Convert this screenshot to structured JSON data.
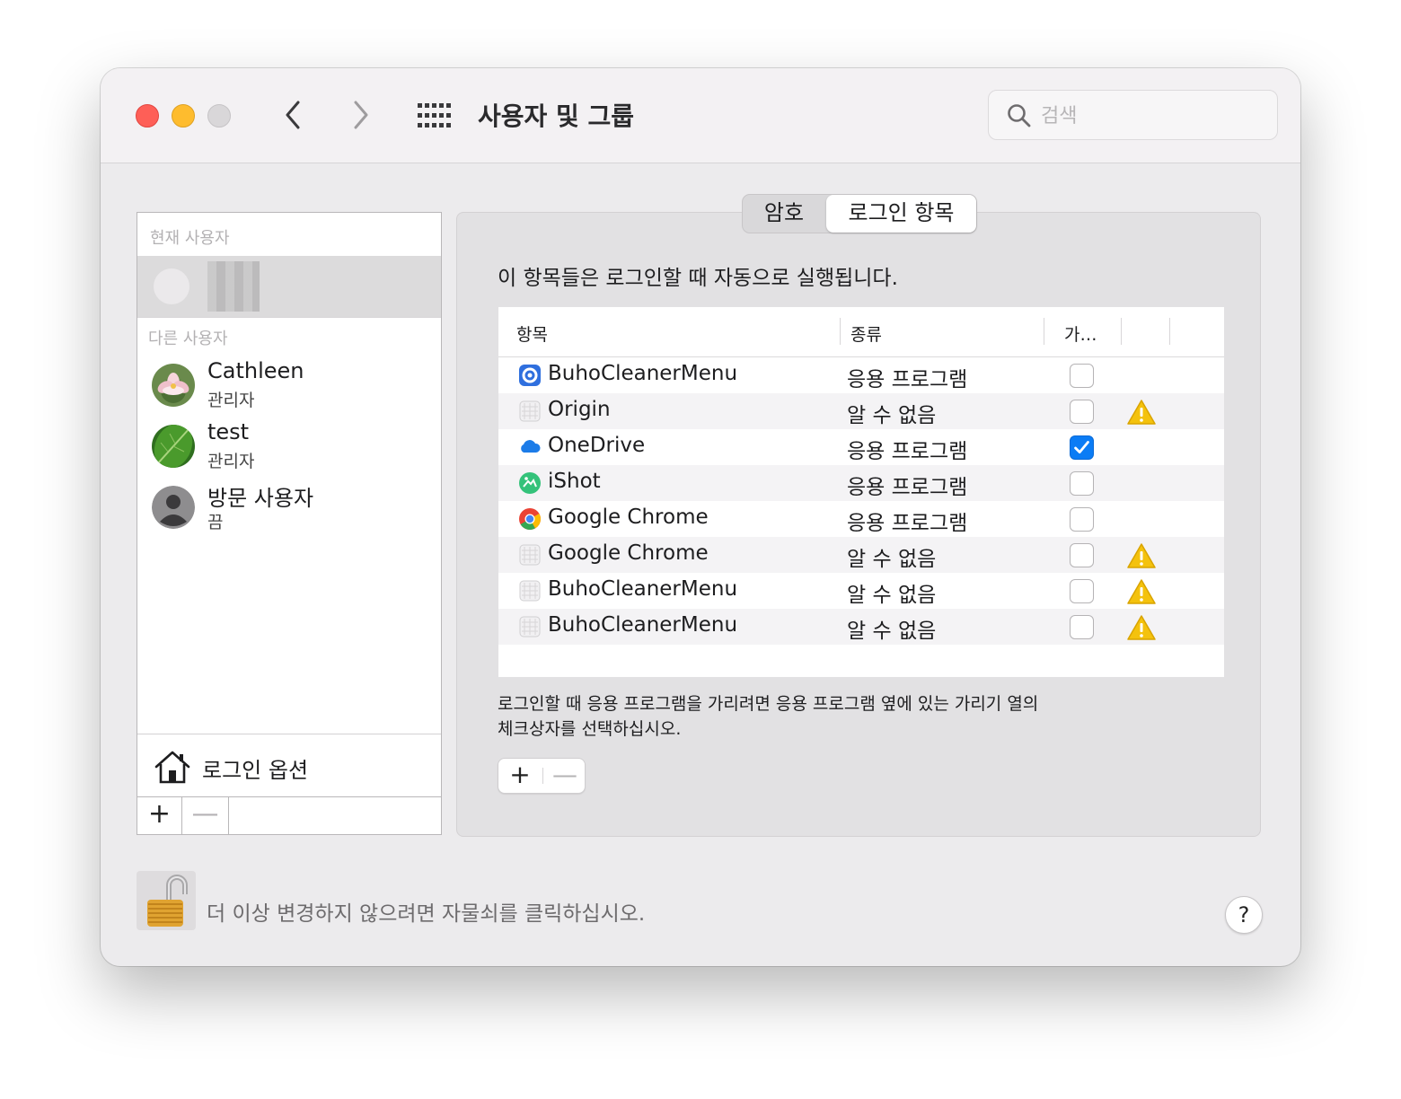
{
  "window": {
    "title": "사용자 및 그룹",
    "search_placeholder": "검색"
  },
  "sidebar": {
    "current_users_header": "현재 사용자",
    "other_users_header": "다른 사용자",
    "users": [
      {
        "name": "Cathleen",
        "role": "관리자",
        "avatar": "lotus-flower-avatar"
      },
      {
        "name": "test",
        "role": "관리자",
        "avatar": "green-leaf-avatar"
      },
      {
        "name": "방문 사용자",
        "role": "끔",
        "avatar": "generic-person-avatar"
      }
    ],
    "login_options_label": "로그인 옵션",
    "add_label": "+",
    "remove_label": "—"
  },
  "tabs": [
    {
      "label": "암호",
      "selected": false
    },
    {
      "label": "로그인 항목",
      "selected": true
    }
  ],
  "login_items": {
    "description": "이 항목들은 로그인할 때 자동으로 실행됩니다.",
    "columns": [
      "항목",
      "종류",
      "가…"
    ],
    "rows": [
      {
        "name": "BuhoCleanerMenu",
        "kind": "응용 프로그램",
        "hide": false,
        "warning": false,
        "icon": "buhocleaner-icon"
      },
      {
        "name": "Origin",
        "kind": "알 수 없음",
        "hide": false,
        "warning": true,
        "icon": "generic-app-icon"
      },
      {
        "name": "OneDrive",
        "kind": "응용 프로그램",
        "hide": true,
        "warning": false,
        "icon": "onedrive-cloud-icon"
      },
      {
        "name": "iShot",
        "kind": "응용 프로그램",
        "hide": false,
        "warning": false,
        "icon": "ishot-icon"
      },
      {
        "name": "Google Chrome",
        "kind": "응용 프로그램",
        "hide": false,
        "warning": false,
        "icon": "chrome-icon"
      },
      {
        "name": "Google Chrome",
        "kind": "알 수 없음",
        "hide": false,
        "warning": true,
        "icon": "generic-app-icon"
      },
      {
        "name": "BuhoCleanerMenu",
        "kind": "알 수 없음",
        "hide": false,
        "warning": true,
        "icon": "generic-app-icon"
      },
      {
        "name": "BuhoCleanerMenu",
        "kind": "알 수 없음",
        "hide": false,
        "warning": true,
        "icon": "generic-app-icon"
      }
    ],
    "hint_line1": "로그인할 때 응용 프로그램을 가리려면 응용 프로그램 옆에 있는 가리기 열의",
    "hint_line2": "체크상자를 선택하십시오.",
    "add_label": "+",
    "remove_label": "—"
  },
  "footer": {
    "lock_text": "더 이상 변경하지 않으려면 자물쇠를 클릭하십시오.",
    "help_label": "?"
  },
  "colors": {
    "checkbox_checked": "#0b7cf5",
    "warning": "#f4c20d",
    "close": "#fe5f57",
    "minimize": "#febc2e"
  }
}
